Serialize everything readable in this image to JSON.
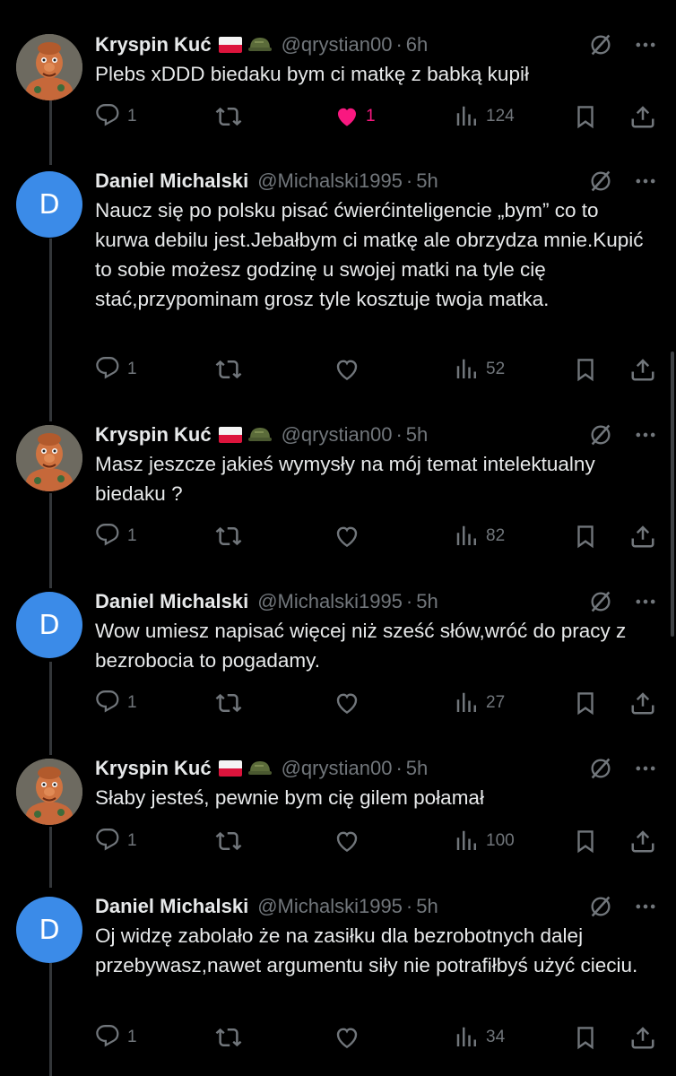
{
  "tweets": [
    {
      "name": "Kryspin Kuć",
      "handle": "@qrystian00",
      "time": "6h",
      "text": "Plebs xDDD biedaku bym ci matkę z babką kupił",
      "replies": "1",
      "reposts": "",
      "likes": "1",
      "views": "124",
      "liked": true
    },
    {
      "name": "Daniel Michalski",
      "handle": "@Michalski1995",
      "time": "5h",
      "avatar_letter": "D",
      "text": "Naucz się po polsku pisać ćwierćinteligencie „bym” co to kurwa debilu jest.Jebałbym ci matkę ale obrzydza mnie.Kupić to sobie możesz godzinę u swojej matki na tyle cię stać,przypominam grosz tyle kosztuje twoja matka.",
      "replies": "1",
      "reposts": "",
      "likes": "",
      "views": "52"
    },
    {
      "name": "Kryspin Kuć",
      "handle": "@qrystian00",
      "time": "5h",
      "text": "Masz jeszcze jakieś wymysły na mój temat intelektualny biedaku ?",
      "replies": "1",
      "reposts": "",
      "likes": "",
      "views": "82"
    },
    {
      "name": "Daniel Michalski",
      "handle": "@Michalski1995",
      "time": "5h",
      "avatar_letter": "D",
      "text": "Wow umiesz napisać więcej niż sześć słów,wróć do pracy z bezrobocia to pogadamy.",
      "replies": "1",
      "reposts": "",
      "likes": "",
      "views": "27"
    },
    {
      "name": "Kryspin Kuć",
      "handle": "@qrystian00",
      "time": "5h",
      "text": "Słaby jesteś, pewnie bym cię gilem połamał",
      "replies": "1",
      "reposts": "",
      "likes": "",
      "views": "100"
    },
    {
      "name": "Daniel Michalski",
      "handle": "@Michalski1995",
      "time": "5h",
      "avatar_letter": "D",
      "text": "Oj widzę zabolało że na zasiłku dla bezrobotnych dalej przebywasz,nawet argumentu siły nie potrafiłbyś użyć cieciu.",
      "replies": "1",
      "reposts": "",
      "likes": "",
      "views": "34"
    }
  ],
  "colors": {
    "background": "#000000",
    "text": "#e7e9ea",
    "muted": "#71767b",
    "like": "#f91880",
    "avatar_d": "#3b8be8"
  },
  "icons": {
    "reply": "reply-icon",
    "repost": "repost-icon",
    "like": "heart-icon",
    "views": "views-icon",
    "bookmark": "bookmark-icon",
    "share": "share-icon",
    "grok": "grok-icon",
    "more": "more-icon"
  }
}
